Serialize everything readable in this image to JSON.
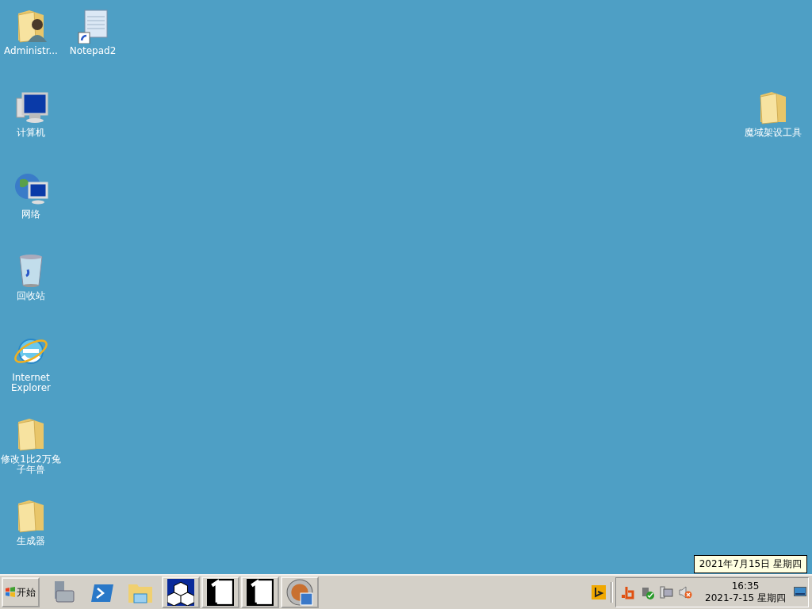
{
  "desktop": {
    "columns": [
      {
        "icons": [
          {
            "label": "Administr...",
            "kind": "user-folder"
          },
          {
            "label": "计算机",
            "kind": "computer"
          },
          {
            "label": "网络",
            "kind": "network"
          },
          {
            "label": "回收站",
            "kind": "recycle-bin"
          },
          {
            "label": "Internet Explorer",
            "kind": "ie"
          },
          {
            "label": "修改1比2万兔子年兽",
            "kind": "folder"
          },
          {
            "label": "生成器",
            "kind": "folder"
          }
        ]
      },
      {
        "icons": [
          {
            "label": "Notepad2",
            "kind": "notepad"
          }
        ]
      }
    ],
    "right_icons": [
      {
        "label": "魔域架设工具",
        "kind": "folder"
      }
    ]
  },
  "tooltip": "2021年7月15日 星期四",
  "taskbar": {
    "start": {
      "label": "开始"
    },
    "quick_launch": [
      {
        "kind": "server-manager"
      },
      {
        "kind": "powershell"
      },
      {
        "kind": "explorer"
      }
    ],
    "windows": [
      {
        "kind": "cubes"
      },
      {
        "kind": "one"
      },
      {
        "kind": "one"
      },
      {
        "kind": "disc"
      }
    ],
    "bing": {
      "kind": "bing"
    },
    "tray": [
      {
        "kind": "b-logo"
      },
      {
        "kind": "plug-check"
      },
      {
        "kind": "network-monitor"
      },
      {
        "kind": "speaker-muted"
      }
    ],
    "clock": {
      "time": "16:35",
      "date": "2021-7-15 星期四"
    }
  }
}
